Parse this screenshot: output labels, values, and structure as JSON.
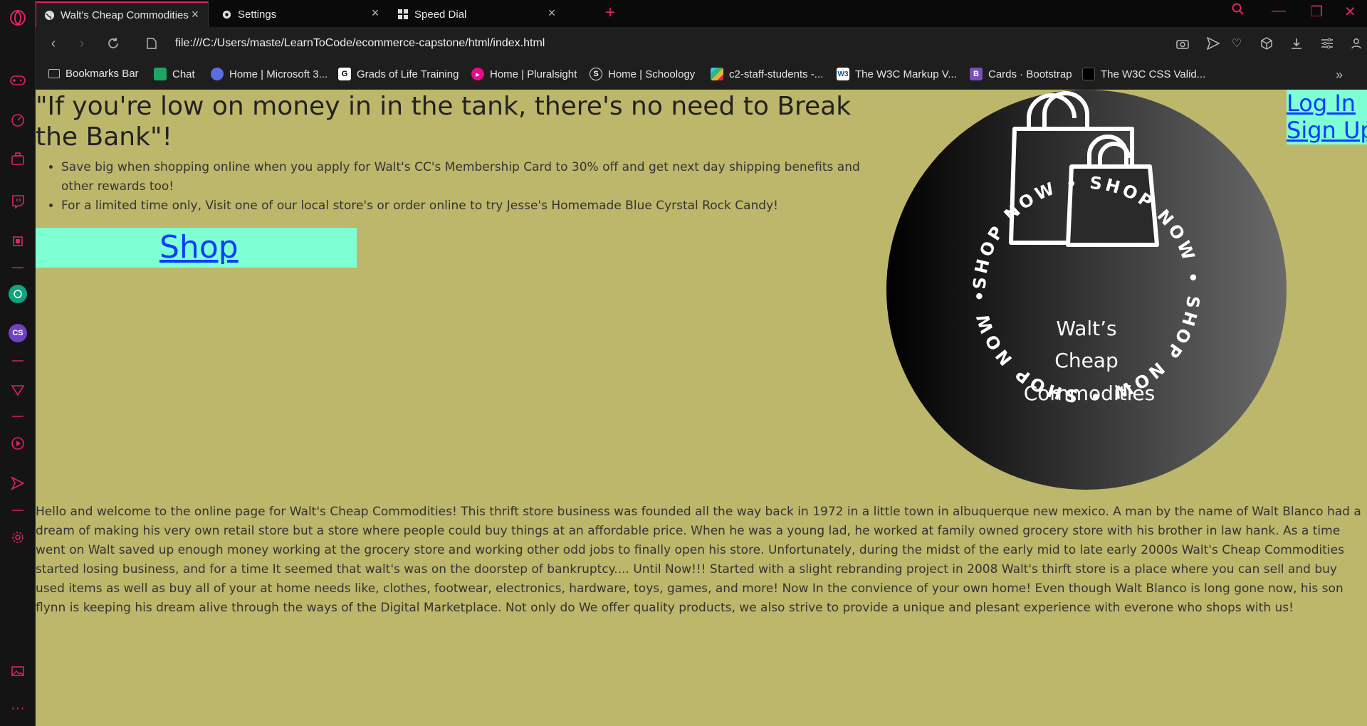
{
  "browser": {
    "tabs": [
      {
        "label": "Walt's Cheap Commodities",
        "icon": "globe-icon",
        "active": true
      },
      {
        "label": "Settings",
        "icon": "gear-icon",
        "active": false
      },
      {
        "label": "Speed Dial",
        "icon": "grid-icon",
        "active": false
      }
    ],
    "url": "file:///C:/Users/maste/LearnToCode/ecommerce-capstone/html/index.html",
    "accent": "#e0245e"
  },
  "bookmarks": [
    {
      "label": "Bookmarks Bar",
      "icon": "folder-icon",
      "color": "#888888"
    },
    {
      "label": "Chat",
      "icon": "chat-icon",
      "color": "#1fa463"
    },
    {
      "label": "Home | Microsoft 3...",
      "icon": "copilot-icon",
      "color": "#5b6ee1"
    },
    {
      "label": "Grads of Life Training",
      "icon": "g-icon",
      "color": "#ffffff"
    },
    {
      "label": "Home | Pluralsight",
      "icon": "pluralsight-icon",
      "color": "#e80a89"
    },
    {
      "label": "Home | Schoology",
      "icon": "schoology-icon",
      "color": "#2b6fb0"
    },
    {
      "label": "c2-staff-students -...",
      "icon": "slack-icon",
      "color": "#e01e5a"
    },
    {
      "label": "The W3C Markup V...",
      "icon": "w3c-icon",
      "color": "#005a9c"
    },
    {
      "label": "Cards · Bootstrap",
      "icon": "bootstrap-icon",
      "color": "#7952b3"
    },
    {
      "label": "The W3C CSS Valid...",
      "icon": "w3c-css-icon",
      "color": "#000000"
    }
  ],
  "page": {
    "background": "#bdb76b",
    "headline": "\"If you're low on money in in the tank, there's no need to Break the Bank\"!",
    "bullets": [
      "Save big when shopping online when you apply for Walt's CC's Membership Card to 30% off and get next day shipping benefits and other rewards too!",
      "For a limited time only, Visit one of our local store's or order online to try Jesse's Homemade Blue Cyrstal Rock Candy!"
    ],
    "shop_label": "Shop",
    "login_label": "Log In",
    "signup_label": "Sign Up",
    "logo": {
      "line1": "Walt’s",
      "line2": "Cheap",
      "line3": "Commodities",
      "ring_text": "SHOP NOW • SHOP NOW • SHOP NOW • SHOP NOW •"
    },
    "about": "Hello and welcome to the online page for Walt's Cheap Commodities! This thrift store business was founded all the way back in 1972 in a little town in albuquerque new mexico. A man by the name of Walt Blanco had a dream of making his very own retail store but a store where people could buy things at an affordable price. When he was a young lad, he worked at family owned grocery store with his brother in law hank. As a time went on Walt saved up enough money working at the grocery store and working other odd jobs to finally open his store. Unfortunately, during the midst of the early mid to late early 2000s Walt's Cheap Commodities started losing business, and for a time It seemed that walt's was on the doorstep of bankruptcy.... Until Now!!! Started with a slight rebranding project in 2008 Walt's thirft store is a place where you can sell and buy used items as well as buy all of your at home needs like, clothes, footwear, electronics, hardware, toys, games, and more! Now In the convience of your own home! Even though Walt Blanco is long gone now, his son flynn is keeping his dream alive through the ways of the Digital Marketplace. Not only do We offer quality products, we also strive to provide a unique and plesant experience with everone who shops with us!"
  }
}
